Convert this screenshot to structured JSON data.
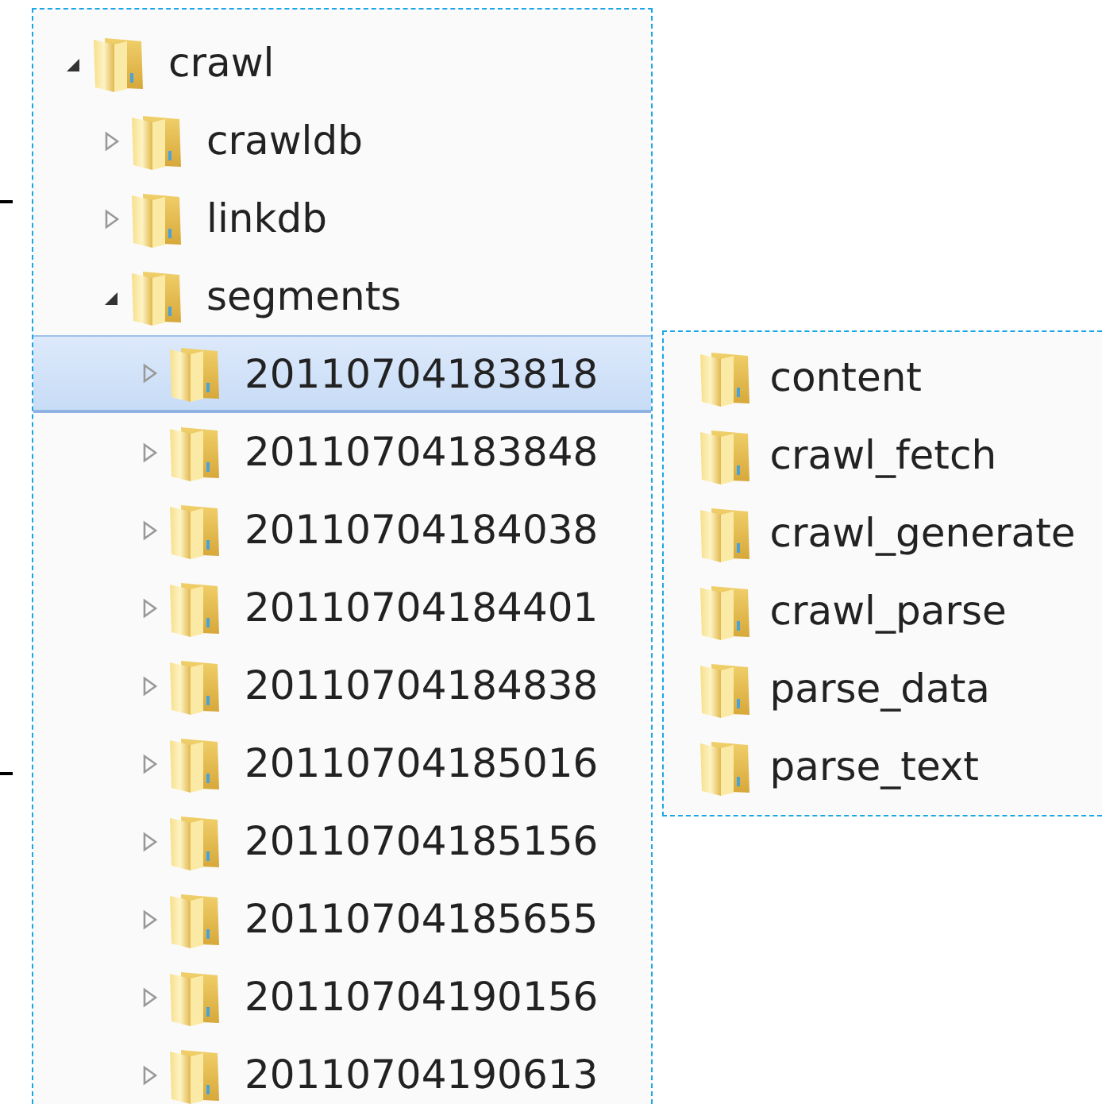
{
  "tree": {
    "nodes": [
      {
        "label": "crawl",
        "expanded": true,
        "selected": false,
        "children": [
          {
            "label": "crawldb",
            "expanded": false,
            "selected": false
          },
          {
            "label": "linkdb",
            "expanded": false,
            "selected": false
          },
          {
            "label": "segments",
            "expanded": true,
            "selected": false,
            "children": [
              {
                "label": "20110704183818",
                "expanded": false,
                "selected": true
              },
              {
                "label": "20110704183848",
                "expanded": false,
                "selected": false
              },
              {
                "label": "20110704184038",
                "expanded": false,
                "selected": false
              },
              {
                "label": "20110704184401",
                "expanded": false,
                "selected": false
              },
              {
                "label": "20110704184838",
                "expanded": false,
                "selected": false
              },
              {
                "label": "20110704185016",
                "expanded": false,
                "selected": false
              },
              {
                "label": "20110704185156",
                "expanded": false,
                "selected": false
              },
              {
                "label": "20110704185655",
                "expanded": false,
                "selected": false
              },
              {
                "label": "20110704190156",
                "expanded": false,
                "selected": false
              },
              {
                "label": "20110704190613",
                "expanded": false,
                "selected": false
              }
            ]
          }
        ]
      }
    ]
  },
  "contents": {
    "items": [
      {
        "label": "content"
      },
      {
        "label": "crawl_fetch"
      },
      {
        "label": "crawl_generate"
      },
      {
        "label": "crawl_parse"
      },
      {
        "label": "parse_data"
      },
      {
        "label": "parse_text"
      }
    ]
  }
}
